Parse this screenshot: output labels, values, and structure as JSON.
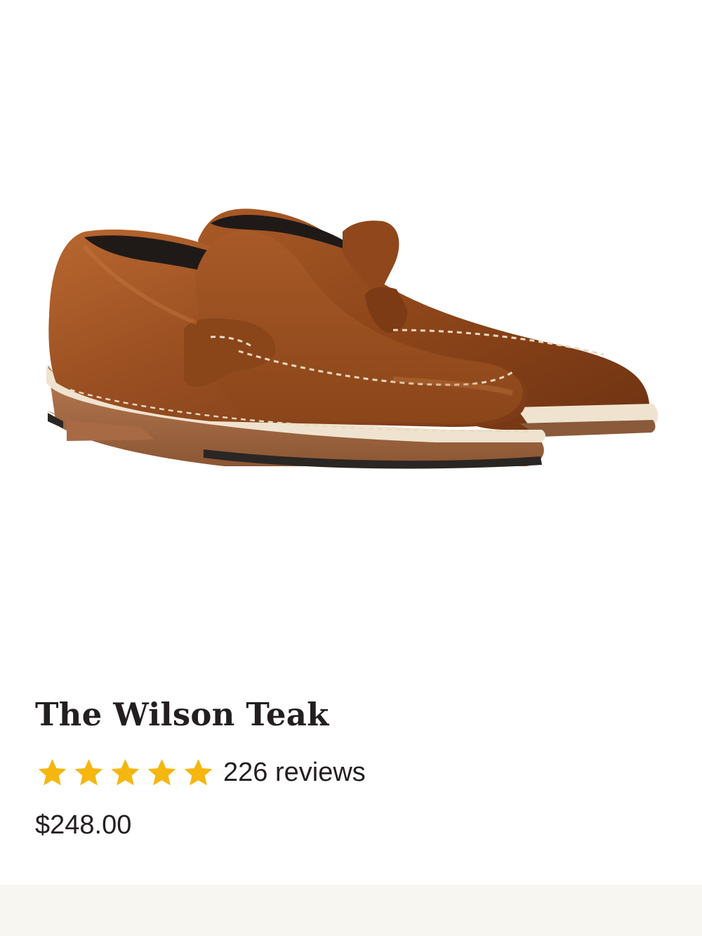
{
  "product": {
    "image_alt": "The Wilson Teak",
    "title": "The Wilson Teak",
    "rating": {
      "stars_filled": 5,
      "stars_total": 5,
      "star_color": "#f5b70f",
      "review_count_text": "226 reviews"
    },
    "price": "$248.00"
  },
  "colors": {
    "leather": "#9a4f22",
    "sole_light": "#efe3cf",
    "sole_wood": "#a86a44",
    "footer_band": "#f8f6f1",
    "text": "#231f20"
  }
}
